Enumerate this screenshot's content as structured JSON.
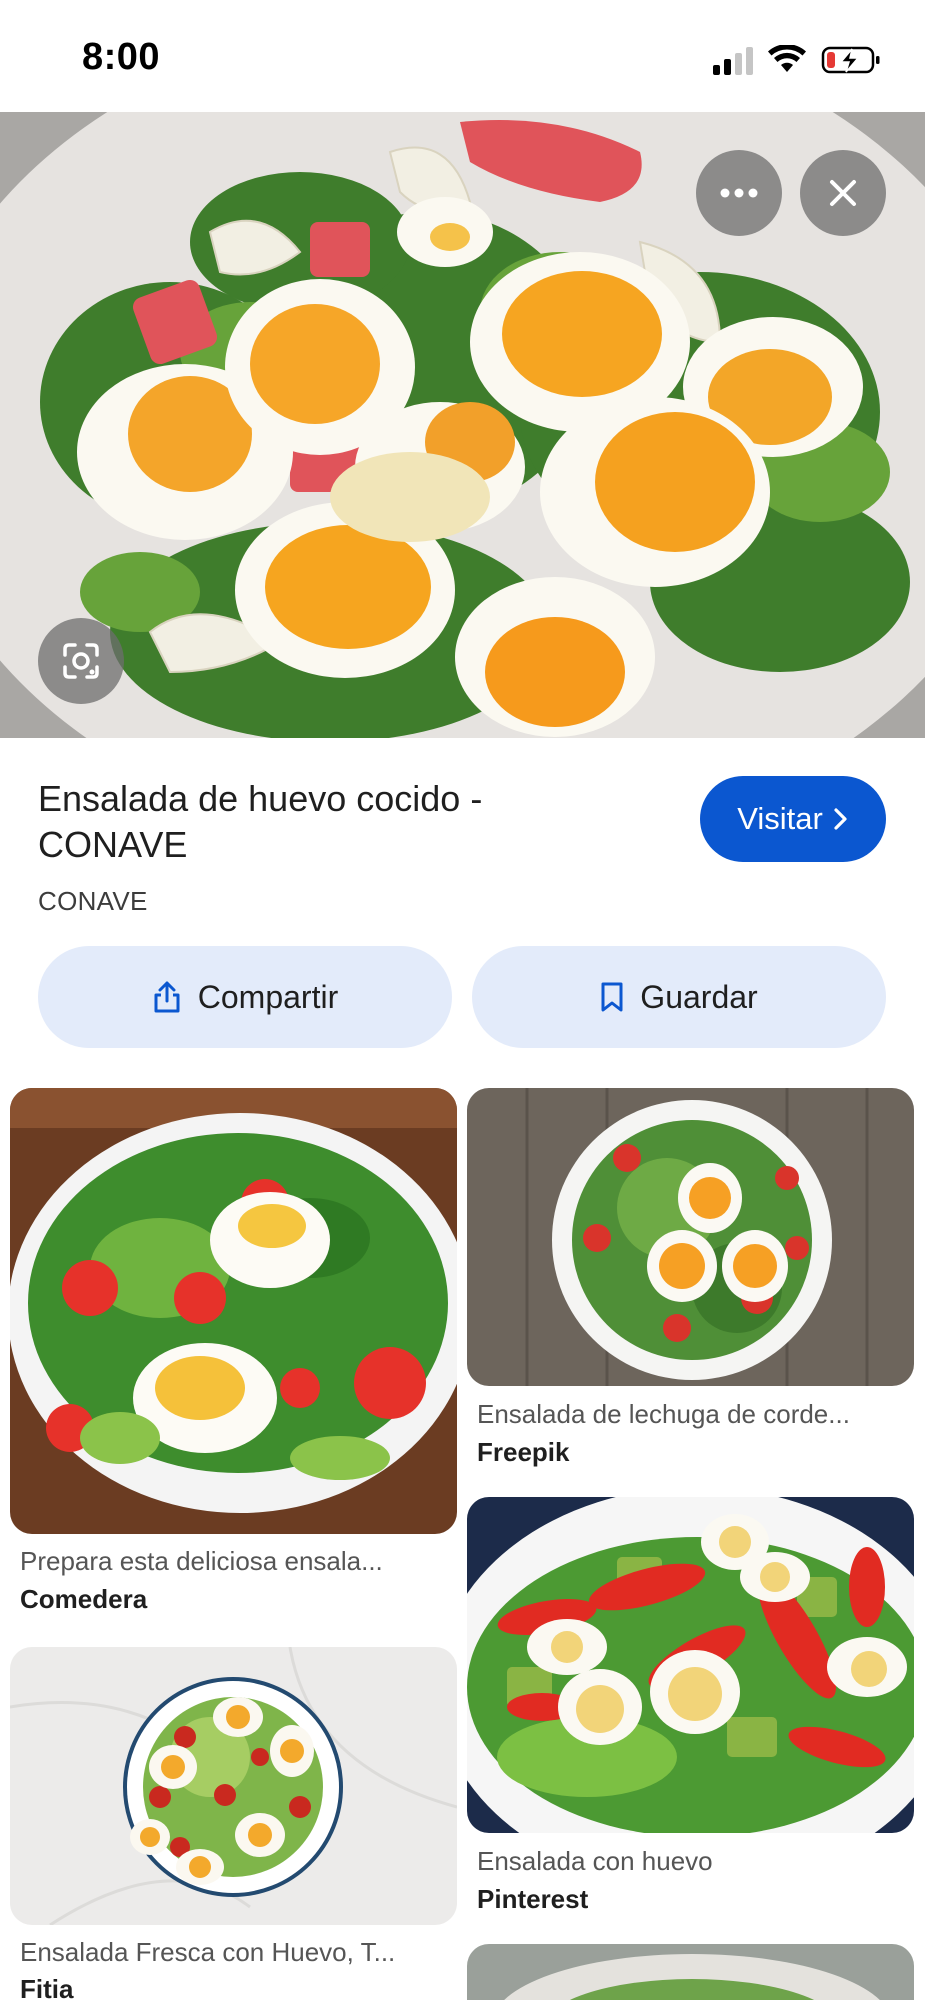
{
  "status_bar": {
    "time": "8:00"
  },
  "result": {
    "title": "Ensalada de huevo cocido - CONAVE",
    "source": "CONAVE",
    "visit_label": "Visitar"
  },
  "actions": {
    "share_label": "Compartir",
    "save_label": "Guardar"
  },
  "related": [
    {
      "caption": "Prepara esta deliciosa ensala...",
      "source": "Comedera"
    },
    {
      "caption": "Ensalada de lechuga de corde...",
      "source": "Freepik"
    },
    {
      "caption": "Ensalada Fresca con Huevo, T...",
      "source": "Fitia"
    },
    {
      "caption": "Ensalada con huevo",
      "source": "Pinterest"
    }
  ],
  "icons": {
    "more": "more-horiz-icon",
    "close": "close-icon",
    "lens": "lens-icon",
    "share": "share-icon",
    "save": "bookmark-icon",
    "visit": "chevron-right-icon"
  },
  "colors": {
    "accent": "#0b57d0",
    "action_bg": "#e3ebfa"
  }
}
